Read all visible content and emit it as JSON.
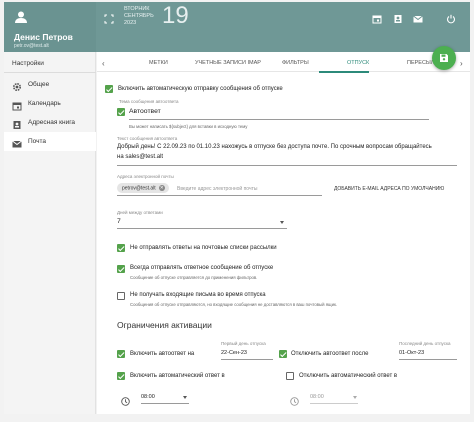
{
  "user": {
    "name": "Денис Петров",
    "email": "petr.ov@test.alt"
  },
  "date": {
    "weekday": "ВТОРНИК",
    "month": "СЕНТЯБРЬ",
    "year": "2023",
    "day": "19"
  },
  "sidebar": {
    "title": "Настройки",
    "items": [
      {
        "label": "Общее",
        "icon": "gear-icon"
      },
      {
        "label": "Календарь",
        "icon": "calendar-icon"
      },
      {
        "label": "Адресная книга",
        "icon": "address-book-icon"
      },
      {
        "label": "Почта",
        "icon": "mail-icon",
        "active": true
      }
    ]
  },
  "tabs": [
    "МЕТКИ",
    "УЧЕТНЫЕ ЗАПИСИ IMAP",
    "ФИЛЬТРЫ",
    "ОТПУСК",
    "ПЕРЕСЫЛКА"
  ],
  "active_tab": "ОТПУСК",
  "vacation": {
    "enable_label": "Включить автоматическую отправку сообщения об отпуске",
    "subject_label": "Тема сообщения автоответа",
    "subject_value": "Автоответ",
    "subject_hint": "Вы может написать ${subject} для вставки в исходную тему",
    "body_label": "Текст сообщения автоответа",
    "body_line1": "Добрый день! С 22.09.23 по 01.10.23 нахожусь в отпуске без доступа почте. По срочным вопросам обращайтесь",
    "body_line2": "на sales@test.alt",
    "address_label": "Адреса электронной почты",
    "address_chip": "petrov@test.alt",
    "address_placeholder": "Введите адрес электронной почты",
    "add_default_button": "ДОБАВИТЬ E-MAIL АДРЕСА ПО УМОЛЧАНИЮ",
    "days_label": "Дней между ответами",
    "days_value": "7",
    "no_lists_label": "Не отправлять ответы на почтовые списки рассылки",
    "always_send_label": "Всегда отправлять ответное сообщение об отпуске",
    "always_send_hint": "Сообщение об отпуске отправляется до применения фильтров.",
    "discard_label": "Не получать входящие письма во время отпуска",
    "discard_hint": "Сообщения об отпуске отправляются, но входящие сообщения не доставляются в ваш почтовый ящик.",
    "activation_title": "Ограничения активации",
    "enable_on_label": "Включить автоответ на",
    "first_day_label": "Первый день отпуска",
    "first_day_value": "22-Сен-23",
    "disable_after_label": "Отключить автоответ после",
    "last_day_label": "Последний день отпуска",
    "last_day_value": "01-Окт-23",
    "enable_at_label": "Включить автоматический ответ в",
    "enable_at_time": "08:00",
    "disable_at_label": "Отключить автоматический ответ в",
    "disable_at_time": "08:00"
  },
  "colors": {
    "header": "#6f9896",
    "accent": "#2c8a7a",
    "check": "#54a24b",
    "fab": "#4caf50"
  }
}
